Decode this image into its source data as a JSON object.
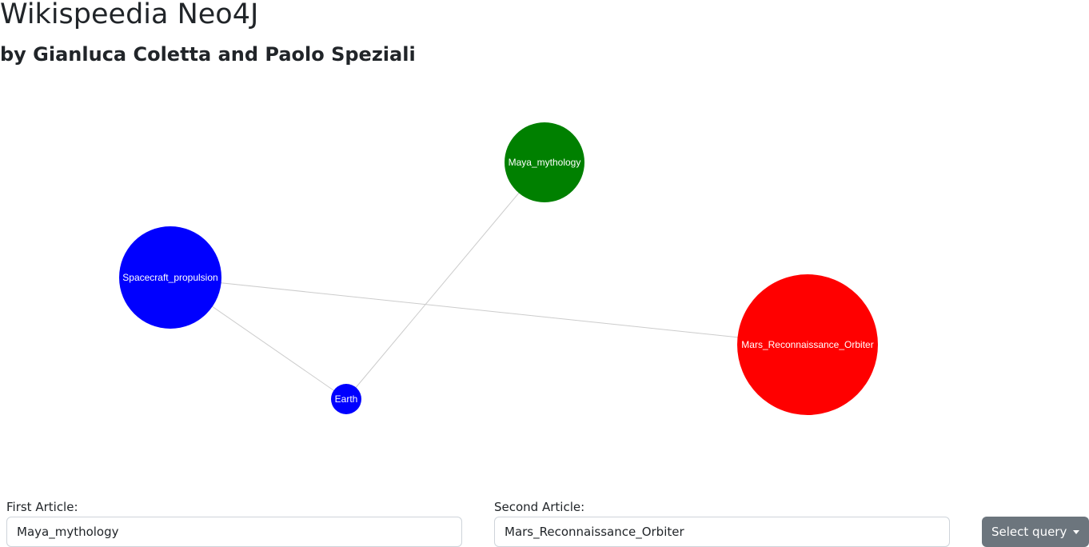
{
  "header": {
    "title": "Wikispeedia Neo4J",
    "subtitle": "by Gianluca Coletta and Paolo Speziali"
  },
  "graph": {
    "nodes": [
      {
        "id": "maya",
        "label": "Maya_mythology",
        "color": "#008000"
      },
      {
        "id": "spacecraft",
        "label": "Spacecraft_propulsion",
        "color": "#0000ff"
      },
      {
        "id": "mars",
        "label": "Mars_Reconnaissance_Orbiter",
        "color": "#ff0000"
      },
      {
        "id": "earth",
        "label": "Earth",
        "color": "#0000ff"
      }
    ],
    "edges": [
      {
        "source": "maya",
        "target": "earth"
      },
      {
        "source": "spacecraft",
        "target": "earth"
      },
      {
        "source": "spacecraft",
        "target": "mars"
      }
    ]
  },
  "form": {
    "first_label": "First Article:",
    "first_value": "Maya_mythology",
    "second_label": "Second Article:",
    "second_value": "Mars_Reconnaissance_Orbiter",
    "query_button_label": "Select query"
  }
}
